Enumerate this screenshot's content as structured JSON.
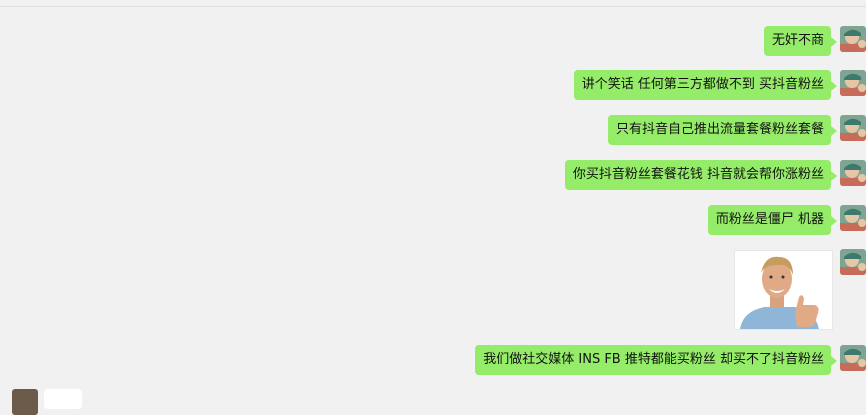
{
  "messages": [
    {
      "text": "无奸不商"
    },
    {
      "text": "讲个笑话  任何第三方都做不到 买抖音粉丝"
    },
    {
      "text": "只有抖音自己推出流量套餐粉丝套餐"
    },
    {
      "text": "你买抖音粉丝套餐花钱 抖音就会帮你涨粉丝"
    },
    {
      "text": "而粉丝是僵尸  机器"
    },
    {
      "text": "我们做社交媒体 INS  FB 推特都能买粉丝 却买不了抖音粉丝"
    }
  ],
  "colors": {
    "background": "#f1f1f1",
    "outgoing_bubble": "#95ec69",
    "incoming_bubble": "#ffffff"
  },
  "icons": {
    "avatar": "user-avatar-icon"
  }
}
